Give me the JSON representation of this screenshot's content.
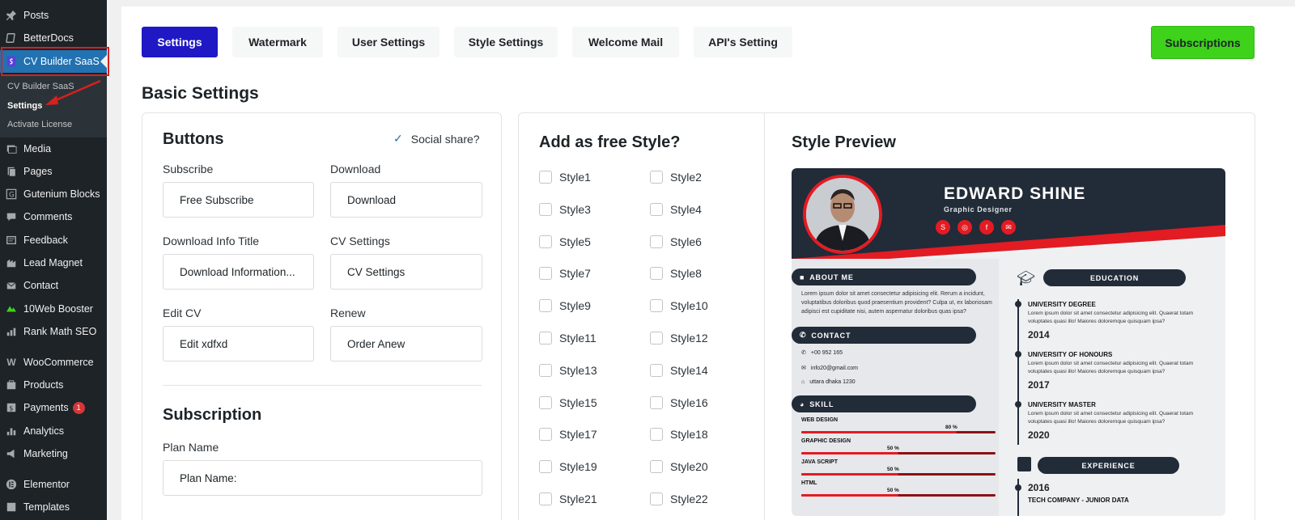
{
  "sidebar": {
    "items": [
      {
        "label": "Posts",
        "icon": "pin-icon"
      },
      {
        "label": "BetterDocs",
        "icon": "docs-icon"
      },
      {
        "label": "CV Builder SaaS",
        "icon": "cv-builder-icon"
      },
      {
        "label": "Media",
        "icon": "media-icon"
      },
      {
        "label": "Pages",
        "icon": "pages-icon"
      },
      {
        "label": "Gutenium Blocks",
        "icon": "gutenium-icon"
      },
      {
        "label": "Comments",
        "icon": "comments-icon"
      },
      {
        "label": "Feedback",
        "icon": "feedback-icon"
      },
      {
        "label": "Lead Magnet",
        "icon": "lead-magnet-icon"
      },
      {
        "label": "Contact",
        "icon": "mail-icon"
      },
      {
        "label": "10Web Booster",
        "icon": "booster-icon"
      },
      {
        "label": "Rank Math SEO",
        "icon": "rank-math-icon"
      },
      {
        "label": "WooCommerce",
        "icon": "woocommerce-icon"
      },
      {
        "label": "Products",
        "icon": "products-icon"
      },
      {
        "label": "Payments",
        "icon": "payments-icon",
        "badge": "1"
      },
      {
        "label": "Analytics",
        "icon": "analytics-icon"
      },
      {
        "label": "Marketing",
        "icon": "marketing-icon"
      },
      {
        "label": "Elementor",
        "icon": "elementor-icon"
      },
      {
        "label": "Templates",
        "icon": "templates-icon"
      }
    ],
    "submenu": [
      "CV Builder SaaS",
      "Settings",
      "Activate License"
    ]
  },
  "tabs": [
    "Settings",
    "Watermark",
    "User Settings",
    "Style Settings",
    "Welcome Mail",
    "API's Setting"
  ],
  "subscriptions_button": "Subscriptions",
  "page_title": "Basic Settings",
  "buttons_section": {
    "title": "Buttons",
    "social_share": "Social share?",
    "fields": [
      {
        "label": "Subscribe",
        "value": "Free Subscribe"
      },
      {
        "label": "Download",
        "value": "Download"
      },
      {
        "label": "Download Info Title",
        "value": "Download Information..."
      },
      {
        "label": "CV Settings",
        "value": "CV Settings"
      },
      {
        "label": "Edit CV",
        "value": "Edit xdfxd"
      },
      {
        "label": "Renew",
        "value": "Order Anew"
      }
    ]
  },
  "subscription_section": {
    "title": "Subscription",
    "plan_label": "Plan Name",
    "plan_value": "Plan Name:"
  },
  "free_style": {
    "title": "Add as free Style?",
    "styles": [
      "Style1",
      "Style2",
      "Style3",
      "Style4",
      "Style5",
      "Style6",
      "Style7",
      "Style8",
      "Style9",
      "Style10",
      "Style11",
      "Style12",
      "Style13",
      "Style14",
      "Style15",
      "Style16",
      "Style17",
      "Style18",
      "Style19",
      "Style20",
      "Style21",
      "Style22"
    ]
  },
  "preview": {
    "title": "Style Preview",
    "name": "EDWARD SHINE",
    "role": "Graphic Designer",
    "about_title": "ABOUT ME",
    "about_text": "Lorem ipsum dolor sit amet consectetur adipisicing elit. Rerum a incidunt, voluptatibus doloribus quod praesentium provident? Culpa ut, ex laboriosam adipisci est cupiditate nisi, autem aspernatur doloribus quas ipsa?",
    "contact_title": "CONTACT",
    "phone": "+00 952 165",
    "email": "info20@gmail.com",
    "address": "uttara dhaka 1230",
    "skill_title": "SKILL",
    "skills": [
      {
        "name": "WEB DESIGN",
        "label": "80 %",
        "level": 80
      },
      {
        "name": "GRAPHIC DESIGN",
        "label": "50 %",
        "level": 50
      },
      {
        "name": "JAVA SCRIPT",
        "label": "50 %",
        "level": 50
      },
      {
        "name": "HTML",
        "label": "50 %",
        "level": 50
      }
    ],
    "education_title": "EDUCATION",
    "education": [
      {
        "degree": "UNIVERSITY DEGREE",
        "text": "Lorem ipsum dolor sit amet consectetur adipisicing elit. Quaerat totam voluptates quasi illo! Maiores doloremque quisquam ipsa?",
        "year": "2014"
      },
      {
        "degree": "UNIVERSITY OF HONOURS",
        "text": "Lorem ipsum dolor sit amet consectetur adipisicing elit. Quaerat totam voluptates quasi illo! Maiores doloremque quisquam ipsa?",
        "year": "2017"
      },
      {
        "degree": "UNIVERSITY MASTER",
        "text": "Lorem ipsum dolor sit amet consectetur adipisicing elit. Quaerat totam voluptates quasi illo! Maiores doloremque quisquam ipsa?",
        "year": "2020"
      }
    ],
    "experience_title": "EXPERIENCE",
    "experience_year": "2016",
    "experience_company": "TECH COMPANY - JUNIOR DATA"
  },
  "colors": {
    "accent": "#1f18c4",
    "subscribe": "#3ed21b",
    "wp_blue": "#2271b1",
    "resume_red": "#e31b23",
    "resume_dark": "#222b38"
  }
}
